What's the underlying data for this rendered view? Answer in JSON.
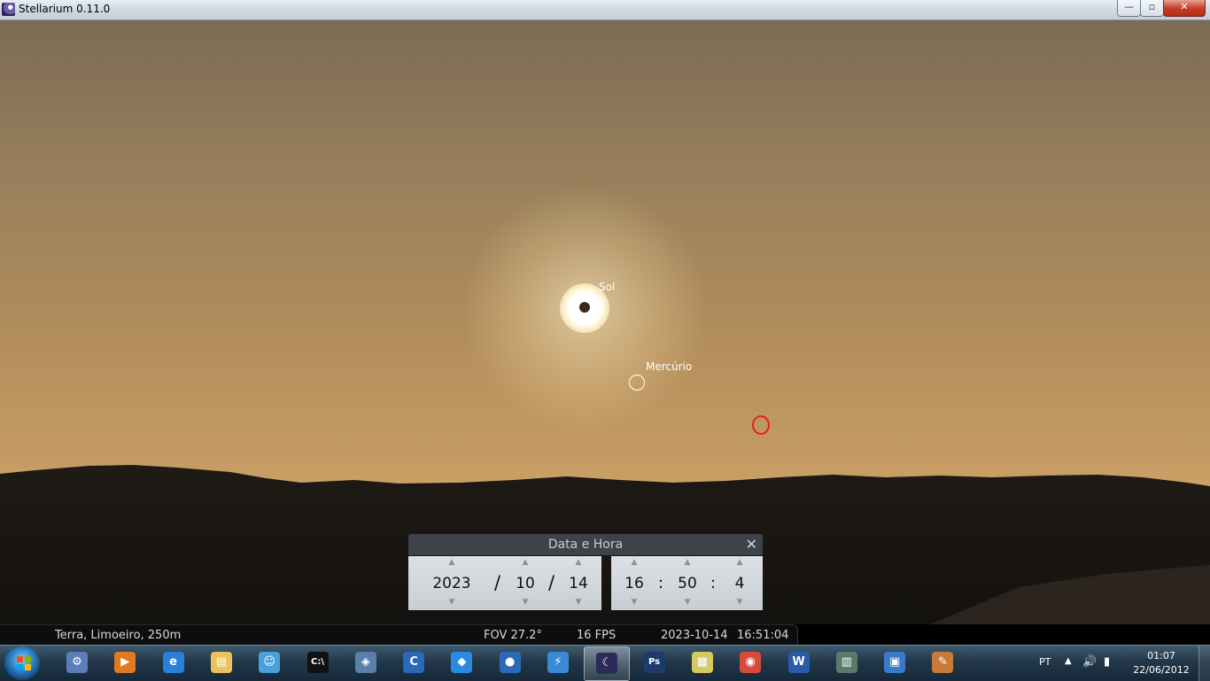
{
  "window": {
    "title": "Stellarium 0.11.0",
    "minimize": "—",
    "maximize": "▫",
    "close": "✕"
  },
  "sky": {
    "sun_label": "Sol",
    "mercury_label": "Mercúrio"
  },
  "dialog": {
    "title": "Data e Hora",
    "close": "✕",
    "year": "2023",
    "month": "10",
    "day": "14",
    "hour": "16",
    "minute": "50",
    "second": "4",
    "date_separator": "/",
    "time_separator": ":"
  },
  "statusbar": {
    "location": "Terra, Limoeiro, 250m",
    "fov": "FOV 27.2°",
    "fps": "16 FPS",
    "date": "2023-10-14",
    "time": "16:51:04"
  },
  "taskbar": {
    "apps": [
      {
        "icon": "app-icon-1",
        "color": "#5a7fb8",
        "glyph": "⚙"
      },
      {
        "icon": "media-player-icon",
        "color": "#e07a20",
        "glyph": "▶"
      },
      {
        "icon": "internet-explorer-icon",
        "color": "#2a7fd8",
        "glyph": "e"
      },
      {
        "icon": "file-explorer-icon",
        "color": "#e8c45a",
        "glyph": "▤"
      },
      {
        "icon": "messenger-icon",
        "color": "#4aa0d8",
        "glyph": "☺"
      },
      {
        "icon": "command-prompt-icon",
        "color": "#111111",
        "glyph": "C:\\"
      },
      {
        "icon": "virtualbox-icon",
        "color": "#5a7fa8",
        "glyph": "◈"
      },
      {
        "icon": "ccleaner-icon",
        "color": "#2a68b8",
        "glyph": "C"
      },
      {
        "icon": "dropbox-icon",
        "color": "#2a8ae0",
        "glyph": "◆"
      },
      {
        "icon": "google-earth-icon",
        "color": "#2a6ab8",
        "glyph": "●"
      },
      {
        "icon": "thunder-icon",
        "color": "#3a8ad8",
        "glyph": "⚡"
      },
      {
        "icon": "stellarium-icon",
        "color": "#2b2a58",
        "glyph": "☾"
      },
      {
        "icon": "photoshop-icon",
        "color": "#1c3c6c",
        "glyph": "Ps"
      },
      {
        "icon": "sticky-notes-icon",
        "color": "#d8c860",
        "glyph": "▦"
      },
      {
        "icon": "chrome-icon",
        "color": "#d84a3a",
        "glyph": "◉"
      },
      {
        "icon": "word-icon",
        "color": "#2a5aa8",
        "glyph": "W"
      },
      {
        "icon": "task-manager-icon",
        "color": "#5a7a6a",
        "glyph": "▥"
      },
      {
        "icon": "control-panel-icon",
        "color": "#3a7ac8",
        "glyph": "▣"
      },
      {
        "icon": "paint-icon",
        "color": "#c87a3a",
        "glyph": "✎"
      }
    ],
    "active_app": "stellarium-icon",
    "language": "PT",
    "tray_arrow": "▲",
    "volume_icon": "🔊",
    "power_icon": "▮",
    "clock_time": "01:07",
    "clock_date": "22/06/2012"
  }
}
